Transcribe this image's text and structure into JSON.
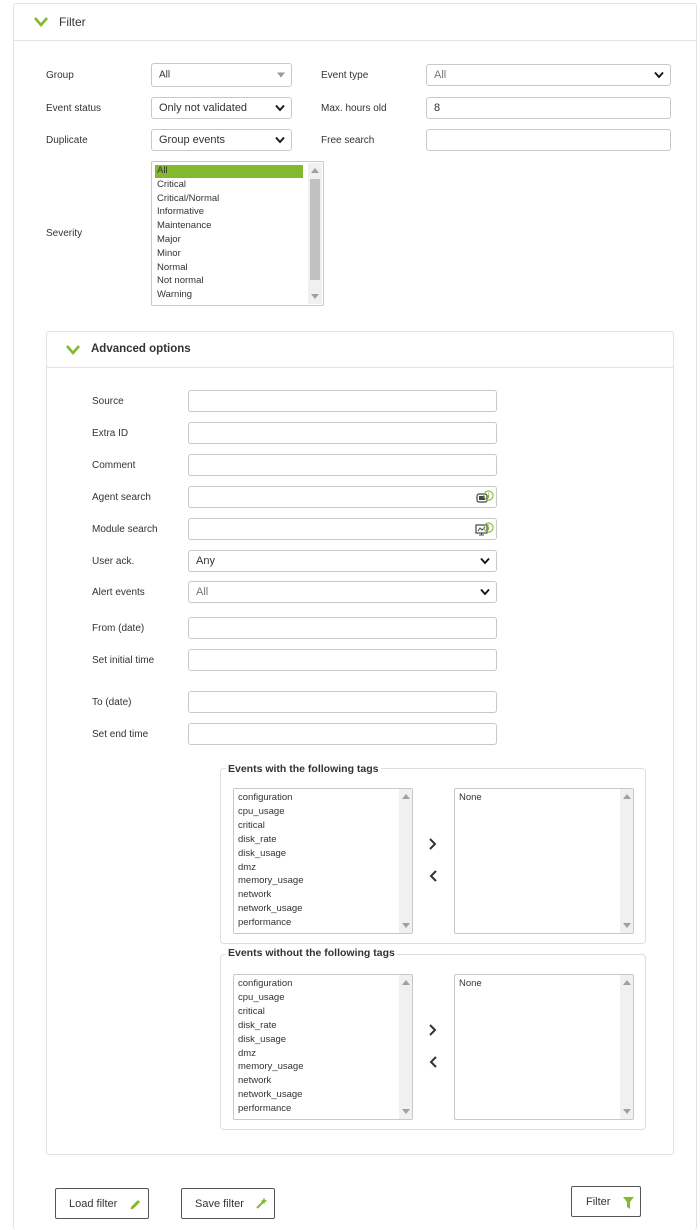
{
  "filter_panel": {
    "title": "Filter"
  },
  "fields": {
    "group_label": "Group",
    "group_value": "All",
    "event_type_label": "Event type",
    "event_type_value": "All",
    "event_status_label": "Event status",
    "event_status_value": "Only not validated",
    "max_hours_label": "Max. hours old",
    "max_hours_value": "8",
    "duplicate_label": "Duplicate",
    "duplicate_value": "Group events",
    "free_search_label": "Free search",
    "free_search_value": "",
    "severity_label": "Severity",
    "severity_options": [
      "All",
      "Critical",
      "Critical/Normal",
      "Informative",
      "Maintenance",
      "Major",
      "Minor",
      "Normal",
      "Not normal",
      "Warning"
    ],
    "severity_selected": "All"
  },
  "advanced": {
    "title": "Advanced options",
    "source_label": "Source",
    "extra_id_label": "Extra ID",
    "comment_label": "Comment",
    "agent_search_label": "Agent search",
    "module_search_label": "Module search",
    "user_ack_label": "User ack.",
    "user_ack_value": "Any",
    "alert_events_label": "Alert events",
    "alert_events_value": "All",
    "from_date_label": "From (date)",
    "initial_time_label": "Set initial time",
    "to_date_label": "To (date)",
    "end_time_label": "Set end time",
    "with_tags": {
      "legend": "Events with the following tags",
      "available": [
        "configuration",
        "cpu_usage",
        "critical",
        "disk_rate",
        "disk_usage",
        "dmz",
        "memory_usage",
        "network",
        "network_usage",
        "performance"
      ],
      "selected": [
        "None"
      ]
    },
    "without_tags": {
      "legend": "Events without the following tags",
      "available": [
        "configuration",
        "cpu_usage",
        "critical",
        "disk_rate",
        "disk_usage",
        "dmz",
        "memory_usage",
        "network",
        "network_usage",
        "performance"
      ],
      "selected": [
        "None"
      ]
    }
  },
  "buttons": {
    "load_filter": "Load filter",
    "save_filter": "Save filter",
    "filter": "Filter"
  },
  "colors": {
    "accent": "#82b92e",
    "highlight": "#82b92e"
  }
}
